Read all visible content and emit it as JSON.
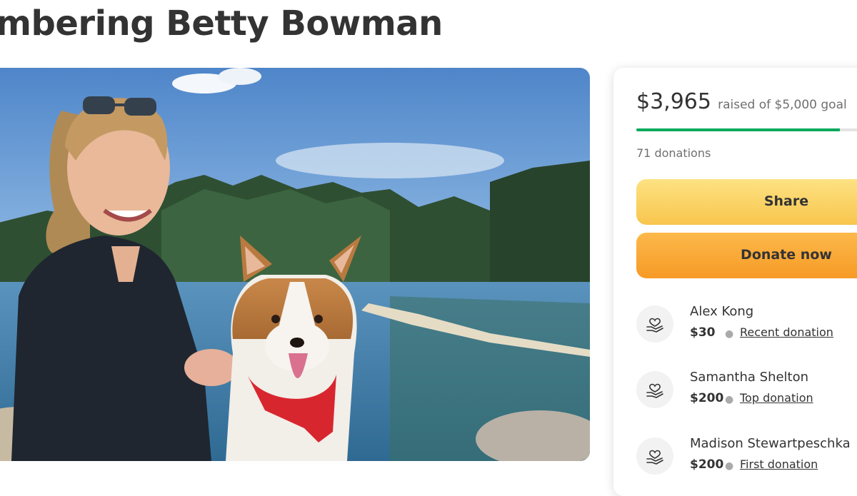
{
  "page": {
    "title": "mbering Betty Bowman"
  },
  "photo": {
    "alt": "Woman with sunglasses on head smiling next to a corgi wearing a red harness by a lake"
  },
  "fundraiser": {
    "raised": "$3,965",
    "goal_text": "raised of $5,000 goal",
    "progress_fraction": 0.793,
    "donations_count": "71 donations",
    "share_label": "Share",
    "donate_label": "Donate now",
    "colors": {
      "progress": "#02a95c",
      "share": "#f8c54c",
      "donate": "#f79a26"
    }
  },
  "donations": [
    {
      "name": "Alex Kong",
      "amount": "$30",
      "type": "Recent donation",
      "icon": "heart-hand-icon"
    },
    {
      "name": "Samantha Shelton",
      "amount": "$200",
      "type": "Top donation",
      "icon": "heart-hand-icon"
    },
    {
      "name": "Madison Stewartpeschka",
      "amount": "$200",
      "type": "First donation",
      "icon": "heart-hand-icon"
    }
  ]
}
